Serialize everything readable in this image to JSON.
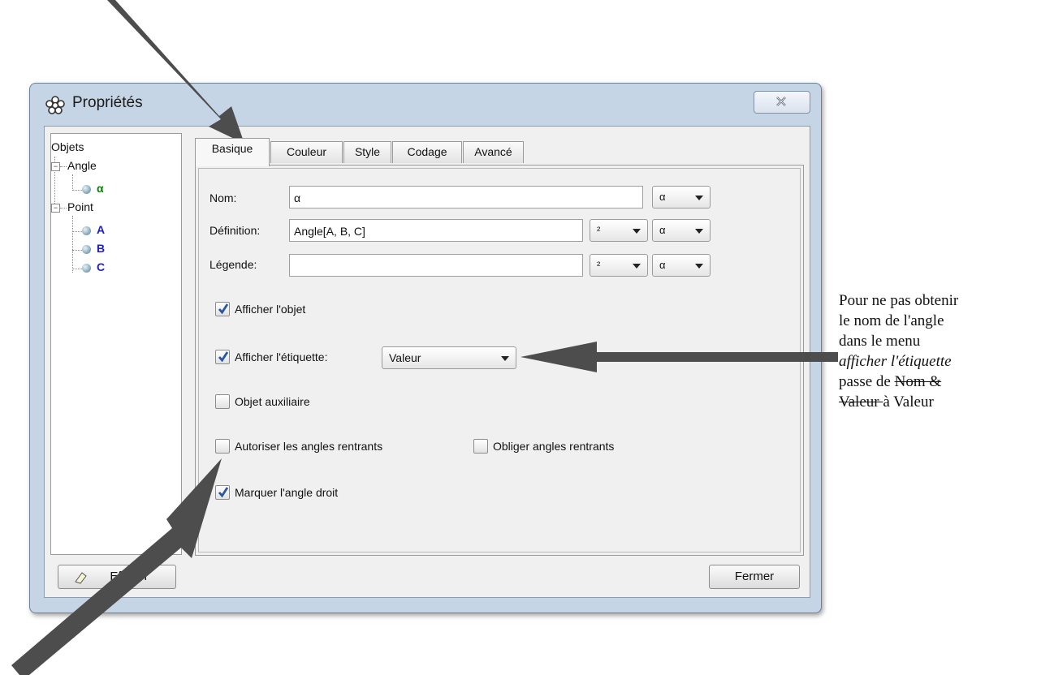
{
  "window": {
    "title": "Propriétés",
    "close_icon": "close-icon",
    "app_icon": "gear-flower-icon"
  },
  "tree": {
    "root": "Objets",
    "groups": [
      {
        "label": "Angle",
        "children": [
          "α"
        ],
        "child_color": "#0b7d0b"
      },
      {
        "label": "Point",
        "children": [
          "A",
          "B",
          "C"
        ],
        "child_color": "#1f1fbf"
      }
    ]
  },
  "tabs": [
    "Basique",
    "Couleur",
    "Style",
    "Codage",
    "Avancé"
  ],
  "active_tab": "Basique",
  "basic": {
    "name_label": "Nom:",
    "name_value": "α",
    "name_combo": "α",
    "definition_label": "Définition:",
    "definition_value": "Angle[A, B, C]",
    "definition_combo1": "²",
    "definition_combo2": "α",
    "caption_label": "Légende:",
    "caption_value": "",
    "caption_combo1": "²",
    "caption_combo2": "α",
    "show_object": {
      "label": "Afficher l'objet",
      "checked": true
    },
    "show_label": {
      "label": "Afficher l'étiquette:",
      "checked": true,
      "value": "Valeur"
    },
    "auxiliary": {
      "label": "Objet auxiliaire",
      "checked": false
    },
    "allow_reflex": {
      "label": "Autoriser les angles rentrants",
      "checked": false
    },
    "force_reflex": {
      "label": "Obliger angles rentrants",
      "checked": false
    },
    "mark_right": {
      "label": "Marquer l'angle droit",
      "checked": true
    }
  },
  "buttons": {
    "delete": "Effacer",
    "close": "Fermer"
  },
  "annotation": {
    "line1": "Pour ne pas obtenir",
    "line2": "le nom de l'angle",
    "line3": "dans le menu",
    "line4_italic": "afficher l'étiquette",
    "line5_prefix": "passe de ",
    "line5_struck": "Nom &",
    "line6_struck": "Valeur ",
    "line6_suffix": " à Valeur"
  },
  "colors": {
    "frame": "#c6d5e6",
    "arrow": "#4d4d4d"
  }
}
